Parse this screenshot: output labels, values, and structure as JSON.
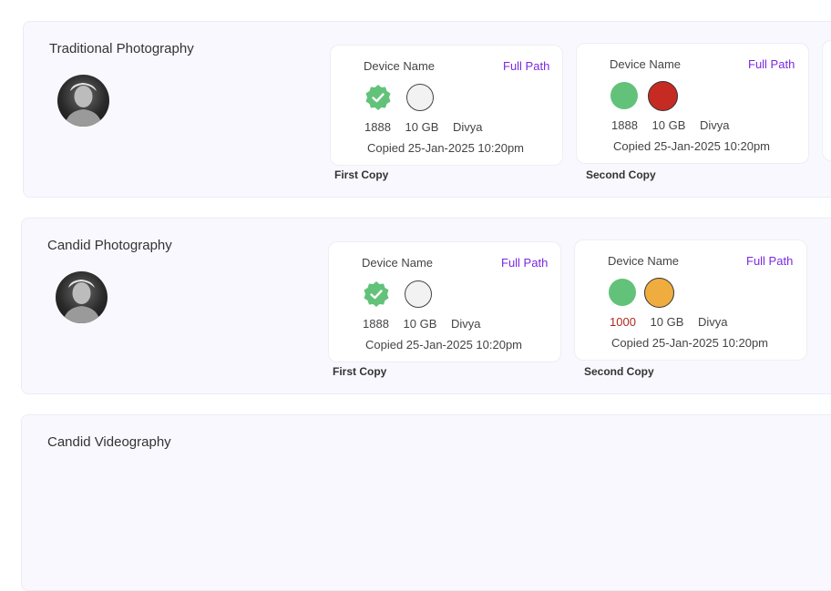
{
  "sections": [
    {
      "title": "Traditional Photography",
      "copies": [
        {
          "device_label": "Device Name",
          "full_path": "Full Path",
          "id": "1888",
          "size": "10 GB",
          "user": "Divya",
          "copied": "Copied 25-Jan-2025 10:20pm",
          "label": "First Copy"
        },
        {
          "device_label": "Device Name",
          "full_path": "Full Path",
          "id": "1888",
          "size": "10 GB",
          "user": "Divya",
          "copied": "Copied 25-Jan-2025 10:20pm",
          "label": "Second Copy"
        }
      ]
    },
    {
      "title": "Candid Photography",
      "copies": [
        {
          "device_label": "Device Name",
          "full_path": "Full Path",
          "id": "1888",
          "size": "10 GB",
          "user": "Divya",
          "copied": "Copied 25-Jan-2025 10:20pm",
          "label": "First Copy"
        },
        {
          "device_label": "Device Name",
          "full_path": "Full Path",
          "id": "1000",
          "size": "10 GB",
          "user": "Divya",
          "copied": "Copied 25-Jan-2025 10:20pm",
          "label": "Second Copy"
        }
      ]
    },
    {
      "title": "Candid Videography"
    }
  ],
  "colors": {
    "accent": "#7a2ae0",
    "status_green": "#62c27a",
    "status_red": "#c52b22",
    "status_orange": "#f0ad3f",
    "warning_text": "#b0281f"
  }
}
